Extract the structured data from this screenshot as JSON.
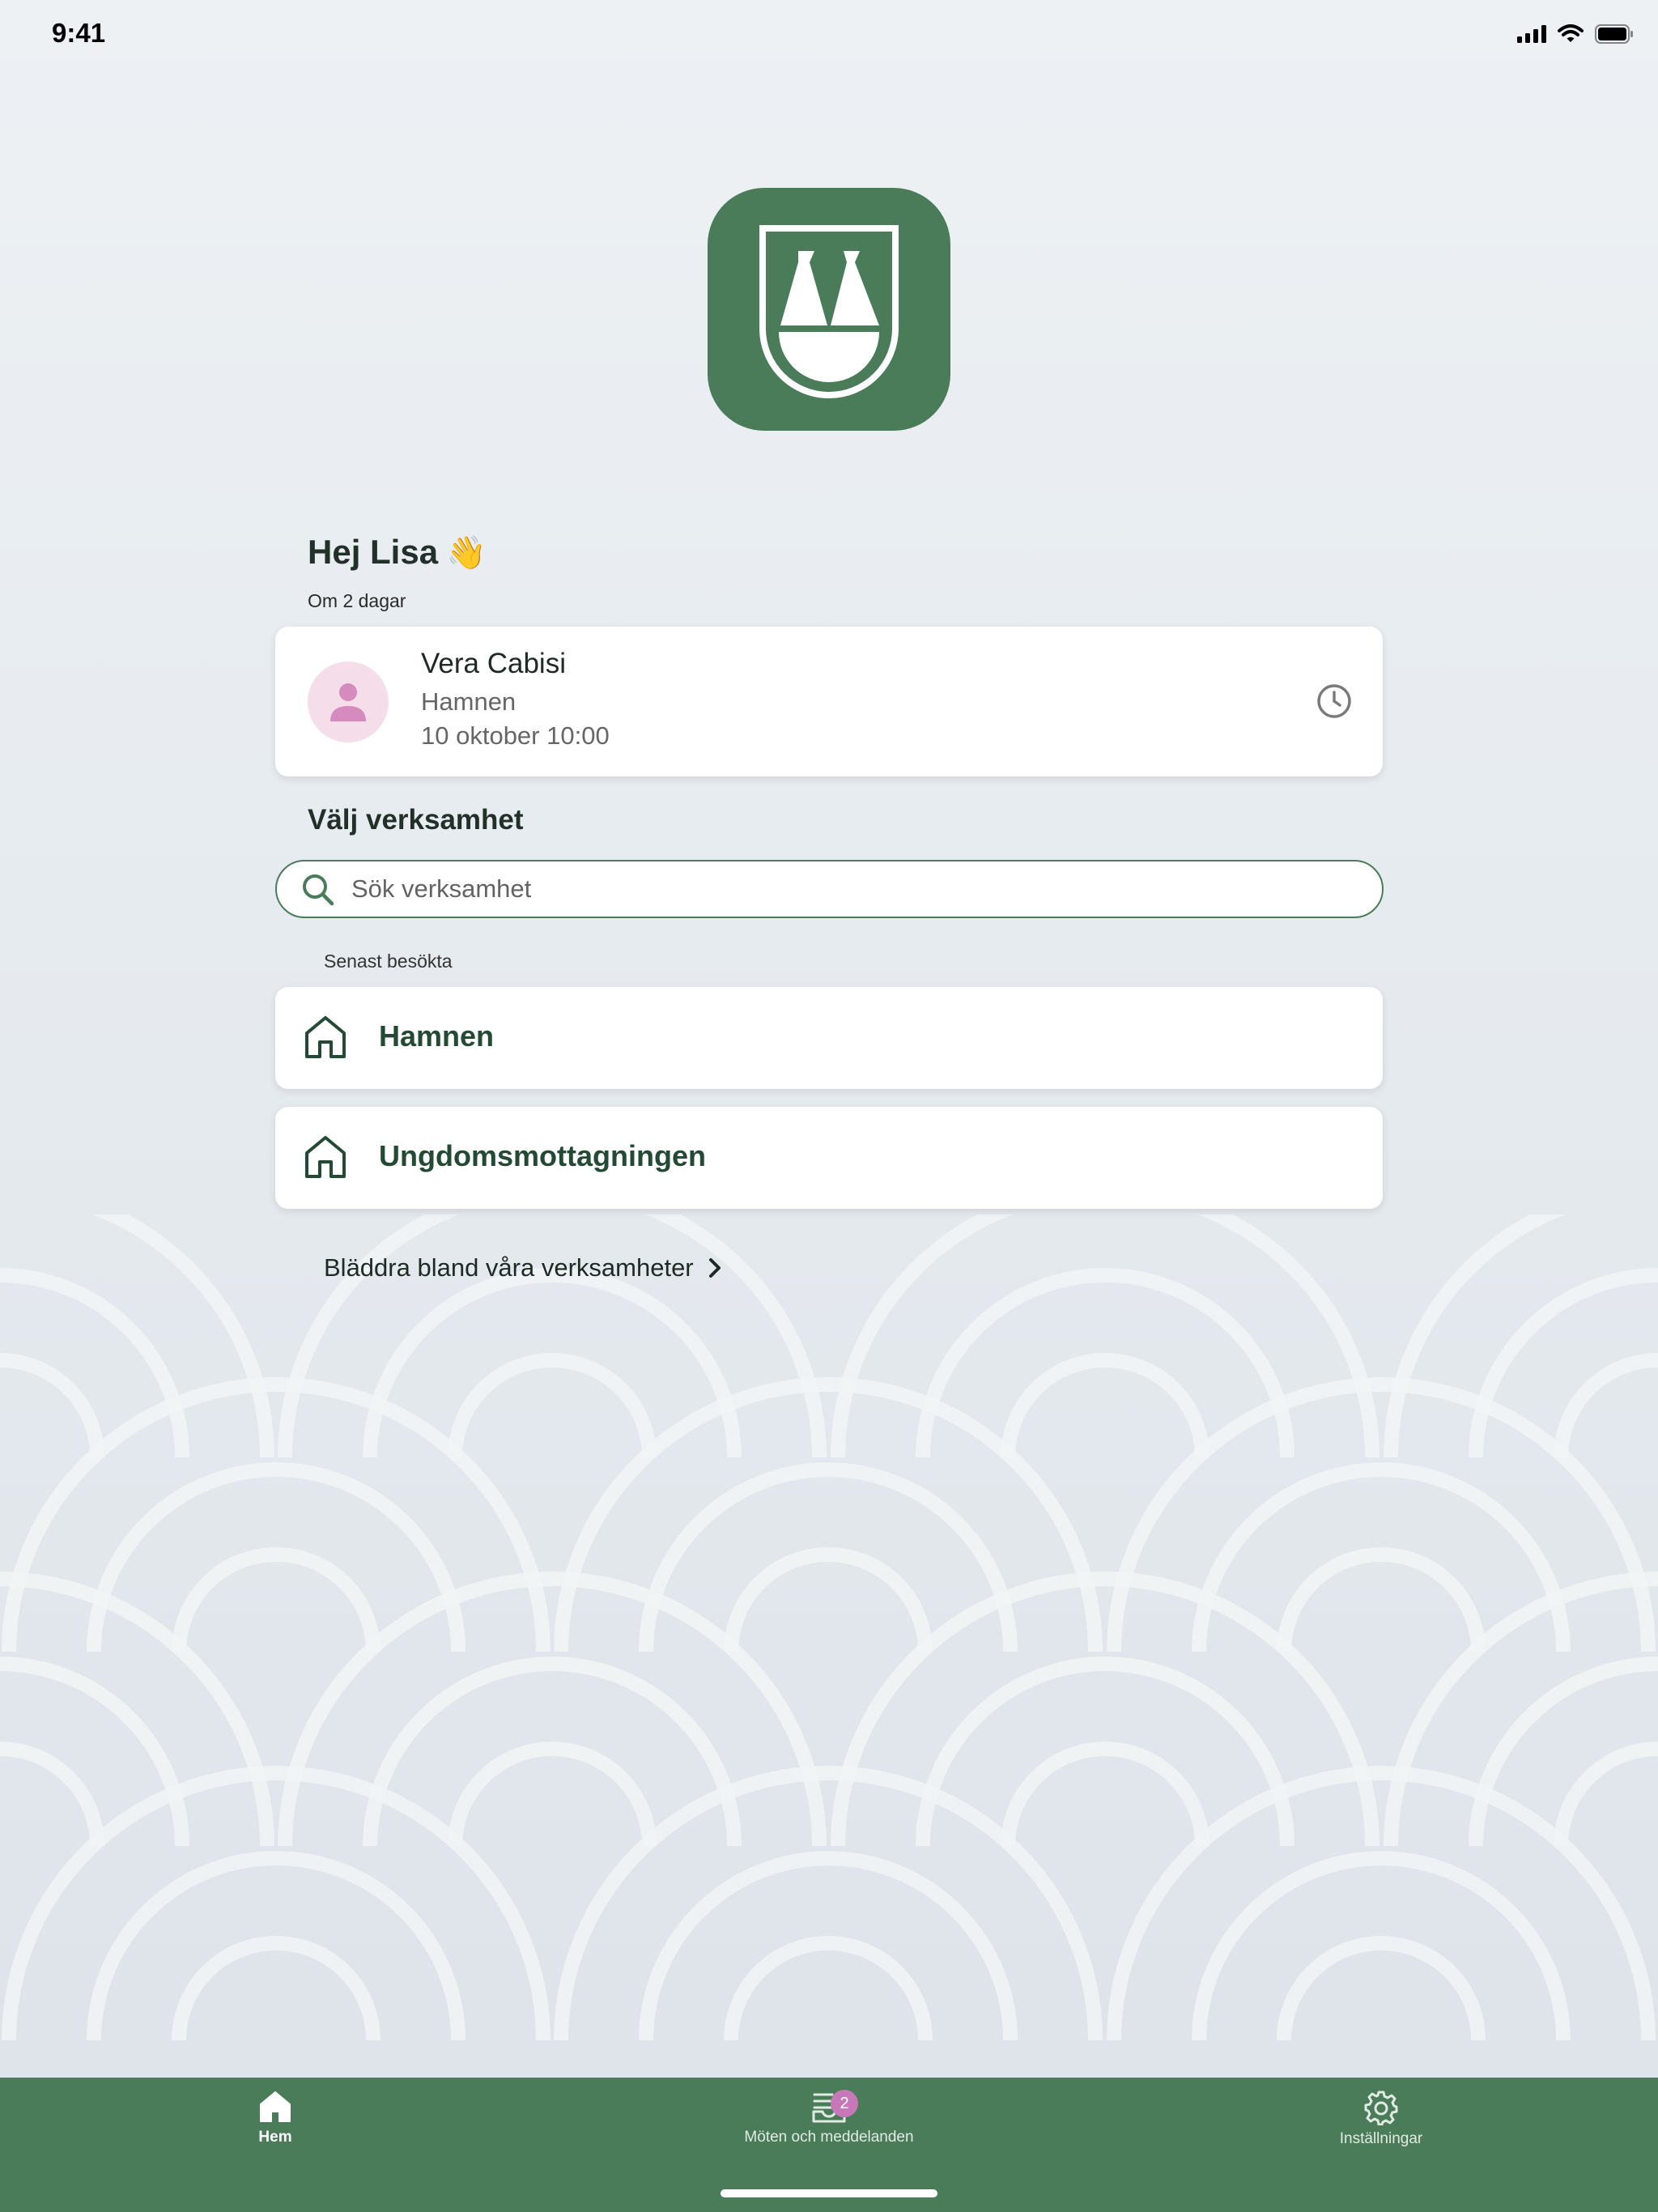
{
  "status_bar": {
    "time": "9:41"
  },
  "greeting": {
    "text": "Hej Lisa",
    "emoji": "👋",
    "subline": "Om 2 dagar"
  },
  "appointment": {
    "name": "Vera Cabisi",
    "place": "Hamnen",
    "datetime": "10 oktober 10:00"
  },
  "venue_section": {
    "title": "Välj verksamhet",
    "search_placeholder": "Sök verksamhet",
    "recent_label": "Senast besökta",
    "recent": [
      {
        "label": "Hamnen"
      },
      {
        "label": "Ungdomsmottagningen"
      }
    ],
    "browse_label": "Bläddra bland våra verksamheter"
  },
  "tabbar": {
    "items": [
      {
        "label": "Hem",
        "icon": "home-icon",
        "active": true
      },
      {
        "label": "Möten och meddelanden",
        "icon": "inbox-icon",
        "badge": "2"
      },
      {
        "label": "Inställningar",
        "icon": "gear-icon"
      }
    ]
  },
  "colors": {
    "brand": "#4a7c59",
    "badge": "#c778b8",
    "avatar_bg": "#f5dde9",
    "avatar_fg": "#d58bbd"
  }
}
